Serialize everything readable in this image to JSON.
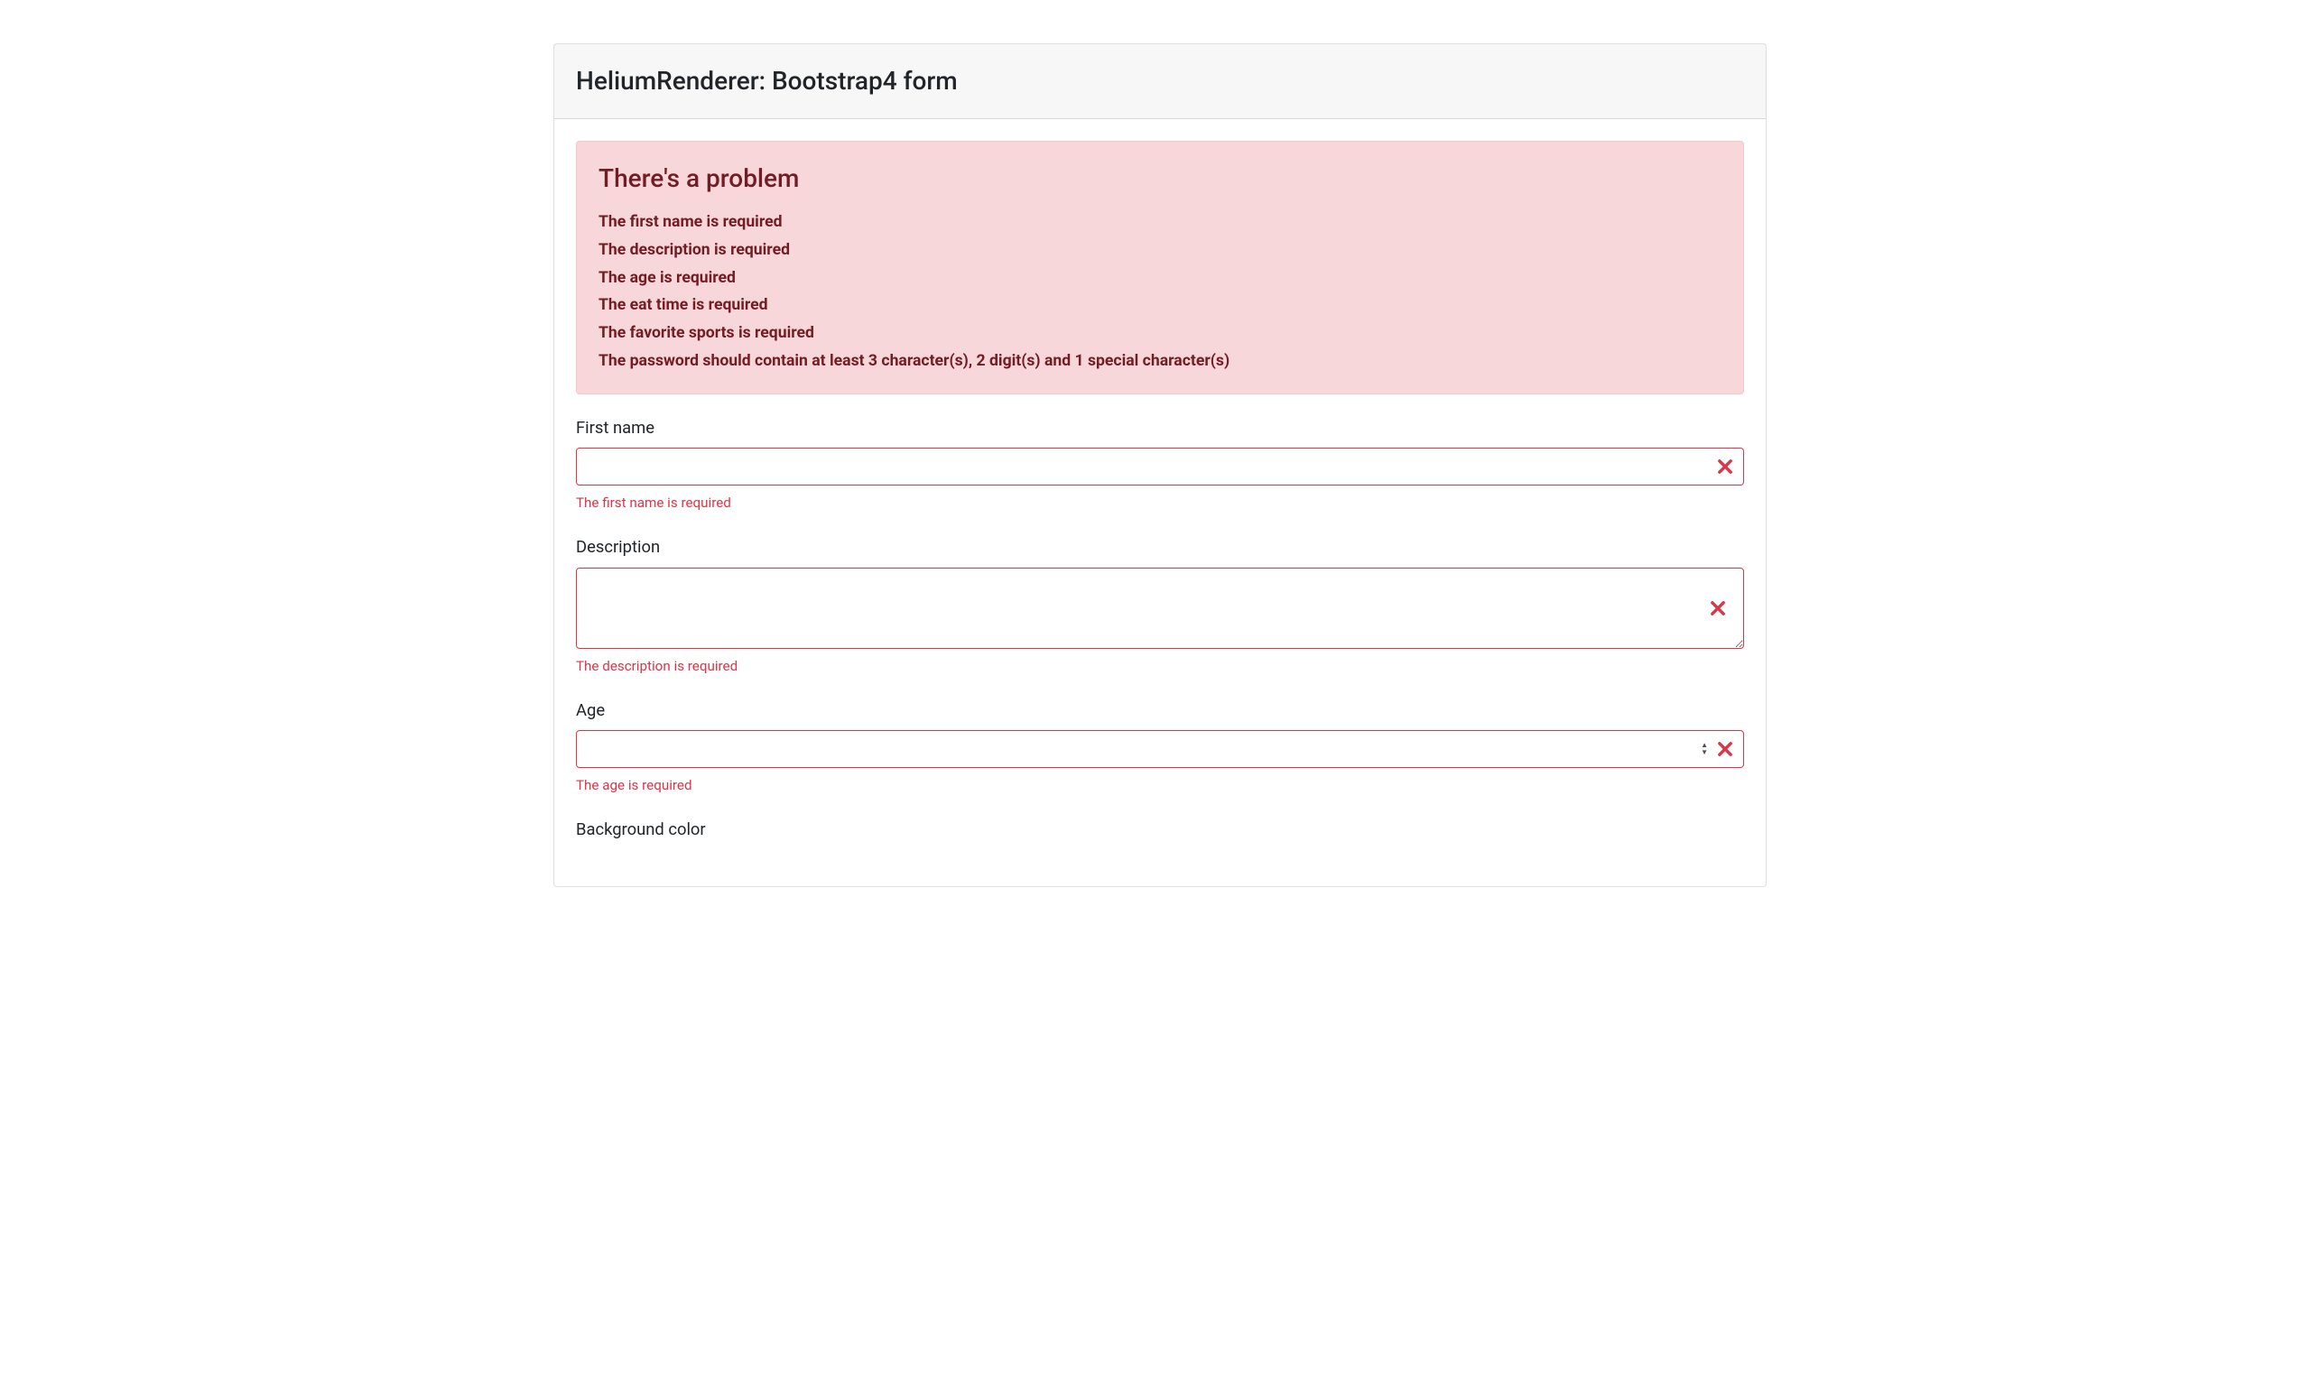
{
  "card": {
    "title": "HeliumRenderer: Bootstrap4 form"
  },
  "alert": {
    "heading": "There's a problem",
    "errors": [
      "The first name is required",
      "The description is required",
      "The age is required",
      "The eat time is required",
      "The favorite sports is required",
      "The password should contain at least 3 character(s), 2 digit(s) and 1 special character(s)"
    ]
  },
  "fields": {
    "first_name": {
      "label": "First name",
      "value": "",
      "error": "The first name is required"
    },
    "description": {
      "label": "Description",
      "value": "",
      "error": "The description is required"
    },
    "age": {
      "label": "Age",
      "value": "",
      "error": "The age is required"
    },
    "background_color": {
      "label": "Background color"
    }
  }
}
